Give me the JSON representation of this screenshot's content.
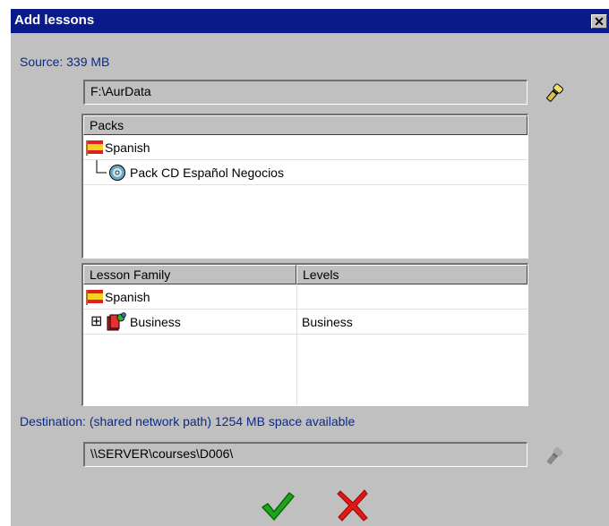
{
  "window": {
    "title": "Add lessons",
    "close_glyph": "✕"
  },
  "source": {
    "label": "Source: 339 MB",
    "path": "F:\\AurData",
    "browse_icon": "flashlight-icon"
  },
  "packs": {
    "header": "Packs",
    "rows": [
      {
        "icon": "spanish-flag-icon",
        "label": "Spanish"
      },
      {
        "icon": "cd-icon",
        "label": "Pack CD Español Negocios"
      }
    ]
  },
  "lessons": {
    "headers": [
      "Lesson Family",
      "Levels"
    ],
    "rows": [
      {
        "icon": "spanish-flag-icon",
        "family": "Spanish",
        "level": ""
      },
      {
        "icon": "book-icon",
        "family": "Business",
        "level": "Business",
        "expander": "⊞"
      }
    ]
  },
  "destination": {
    "label": "Destination: (shared network path) 1254 MB space available",
    "path": "\\\\SERVER\\courses\\D006\\",
    "browse_icon": "flashlight-icon"
  },
  "actions": {
    "ok_icon": "checkmark-icon",
    "cancel_icon": "cross-icon"
  },
  "colors": {
    "titlebar": "#0a1a8a",
    "label_blue": "#0a2a8a",
    "ok_green": "#1aa51a",
    "cancel_red": "#e01818"
  }
}
